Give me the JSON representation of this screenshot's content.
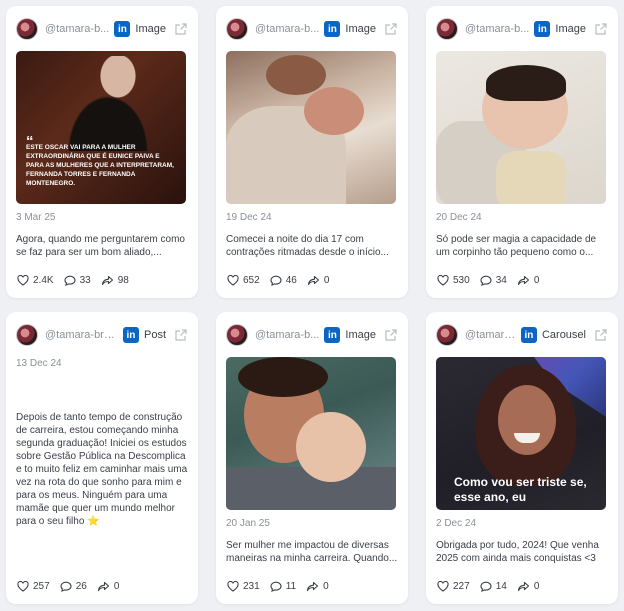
{
  "posts": [
    {
      "handle": "@tamara-b...",
      "platform_badge": "in",
      "post_type": "Image",
      "overlay_quote": "“",
      "overlay_text": "ESTE OSCAR VAI PARA A MULHER EXTRAORDINÁRIA QUE É EUNICE PAIVA E PARA AS MULHERES QUE A INTERPRETARAM, FERNANDA TORRES E FERNANDA MONTENEGRO.",
      "date": "3 Mar 25",
      "caption": "Agora, quando me perguntarem como se faz para ser um bom aliado,...",
      "likes": "2.4K",
      "comments": "33",
      "shares": "98"
    },
    {
      "handle": "@tamara-b...",
      "platform_badge": "in",
      "post_type": "Image",
      "date": "19 Dec 24",
      "caption": "Comecei a noite do dia 17 com contrações ritmadas desde o início...",
      "likes": "652",
      "comments": "46",
      "shares": "0"
    },
    {
      "handle": "@tamara-b...",
      "platform_badge": "in",
      "post_type": "Image",
      "date": "20 Dec 24",
      "caption": "Só pode ser magia a capacidade de um corpinho tão pequeno como o...",
      "likes": "530",
      "comments": "34",
      "shares": "0"
    },
    {
      "handle": "@tamara-bra...",
      "platform_badge": "in",
      "post_type": "Post",
      "date": "13 Dec 24",
      "caption": "Depois de tanto tempo de construção de carreira, estou começando minha segunda graduação! Iniciei os estudos sobre Gestão Pública na Descomplica e to muito feliz em caminhar mais uma vez na rota do que sonho para mim e para os meus. Ninguém para uma mamãe que quer um mundo melhor para o seu filho ⭐",
      "likes": "257",
      "comments": "26",
      "shares": "0"
    },
    {
      "handle": "@tamara-b...",
      "platform_badge": "in",
      "post_type": "Image",
      "date": "20 Jan 25",
      "caption": "Ser mulher me impactou de diversas maneiras na minha carreira. Quando...",
      "likes": "231",
      "comments": "11",
      "shares": "0"
    },
    {
      "handle": "@tamara...",
      "platform_badge": "in",
      "post_type": "Carousel",
      "overlay_text": "Como vou ser triste se, esse ano, eu",
      "date": "2 Dec 24",
      "caption": "Obrigada por tudo, 2024! Que venha 2025 com ainda mais conquistas <3",
      "likes": "227",
      "comments": "14",
      "shares": "0"
    }
  ],
  "icons": {
    "like": "heart-icon",
    "comment": "comment-icon",
    "share": "share-icon",
    "open": "external-link-icon",
    "platform": "linkedin-icon"
  },
  "colors": {
    "background": "#eef0f3",
    "card": "#ffffff",
    "linkedin": "#0a66c2",
    "muted_text": "#8a9099",
    "text": "#3a3f47"
  }
}
